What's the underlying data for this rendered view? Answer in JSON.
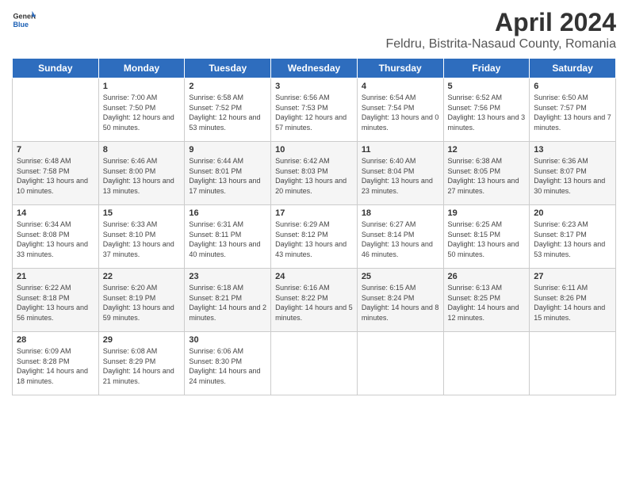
{
  "header": {
    "logo_general": "General",
    "logo_blue": "Blue",
    "title": "April 2024",
    "subtitle": "Feldru, Bistrita-Nasaud County, Romania"
  },
  "calendar": {
    "days_of_week": [
      "Sunday",
      "Monday",
      "Tuesday",
      "Wednesday",
      "Thursday",
      "Friday",
      "Saturday"
    ],
    "weeks": [
      [
        {
          "day": "",
          "content": ""
        },
        {
          "day": "1",
          "content": "Sunrise: 7:00 AM\nSunset: 7:50 PM\nDaylight: 12 hours\nand 50 minutes."
        },
        {
          "day": "2",
          "content": "Sunrise: 6:58 AM\nSunset: 7:52 PM\nDaylight: 12 hours\nand 53 minutes."
        },
        {
          "day": "3",
          "content": "Sunrise: 6:56 AM\nSunset: 7:53 PM\nDaylight: 12 hours\nand 57 minutes."
        },
        {
          "day": "4",
          "content": "Sunrise: 6:54 AM\nSunset: 7:54 PM\nDaylight: 13 hours\nand 0 minutes."
        },
        {
          "day": "5",
          "content": "Sunrise: 6:52 AM\nSunset: 7:56 PM\nDaylight: 13 hours\nand 3 minutes."
        },
        {
          "day": "6",
          "content": "Sunrise: 6:50 AM\nSunset: 7:57 PM\nDaylight: 13 hours\nand 7 minutes."
        }
      ],
      [
        {
          "day": "7",
          "content": "Sunrise: 6:48 AM\nSunset: 7:58 PM\nDaylight: 13 hours\nand 10 minutes."
        },
        {
          "day": "8",
          "content": "Sunrise: 6:46 AM\nSunset: 8:00 PM\nDaylight: 13 hours\nand 13 minutes."
        },
        {
          "day": "9",
          "content": "Sunrise: 6:44 AM\nSunset: 8:01 PM\nDaylight: 13 hours\nand 17 minutes."
        },
        {
          "day": "10",
          "content": "Sunrise: 6:42 AM\nSunset: 8:03 PM\nDaylight: 13 hours\nand 20 minutes."
        },
        {
          "day": "11",
          "content": "Sunrise: 6:40 AM\nSunset: 8:04 PM\nDaylight: 13 hours\nand 23 minutes."
        },
        {
          "day": "12",
          "content": "Sunrise: 6:38 AM\nSunset: 8:05 PM\nDaylight: 13 hours\nand 27 minutes."
        },
        {
          "day": "13",
          "content": "Sunrise: 6:36 AM\nSunset: 8:07 PM\nDaylight: 13 hours\nand 30 minutes."
        }
      ],
      [
        {
          "day": "14",
          "content": "Sunrise: 6:34 AM\nSunset: 8:08 PM\nDaylight: 13 hours\nand 33 minutes."
        },
        {
          "day": "15",
          "content": "Sunrise: 6:33 AM\nSunset: 8:10 PM\nDaylight: 13 hours\nand 37 minutes."
        },
        {
          "day": "16",
          "content": "Sunrise: 6:31 AM\nSunset: 8:11 PM\nDaylight: 13 hours\nand 40 minutes."
        },
        {
          "day": "17",
          "content": "Sunrise: 6:29 AM\nSunset: 8:12 PM\nDaylight: 13 hours\nand 43 minutes."
        },
        {
          "day": "18",
          "content": "Sunrise: 6:27 AM\nSunset: 8:14 PM\nDaylight: 13 hours\nand 46 minutes."
        },
        {
          "day": "19",
          "content": "Sunrise: 6:25 AM\nSunset: 8:15 PM\nDaylight: 13 hours\nand 50 minutes."
        },
        {
          "day": "20",
          "content": "Sunrise: 6:23 AM\nSunset: 8:17 PM\nDaylight: 13 hours\nand 53 minutes."
        }
      ],
      [
        {
          "day": "21",
          "content": "Sunrise: 6:22 AM\nSunset: 8:18 PM\nDaylight: 13 hours\nand 56 minutes."
        },
        {
          "day": "22",
          "content": "Sunrise: 6:20 AM\nSunset: 8:19 PM\nDaylight: 13 hours\nand 59 minutes."
        },
        {
          "day": "23",
          "content": "Sunrise: 6:18 AM\nSunset: 8:21 PM\nDaylight: 14 hours\nand 2 minutes."
        },
        {
          "day": "24",
          "content": "Sunrise: 6:16 AM\nSunset: 8:22 PM\nDaylight: 14 hours\nand 5 minutes."
        },
        {
          "day": "25",
          "content": "Sunrise: 6:15 AM\nSunset: 8:24 PM\nDaylight: 14 hours\nand 8 minutes."
        },
        {
          "day": "26",
          "content": "Sunrise: 6:13 AM\nSunset: 8:25 PM\nDaylight: 14 hours\nand 12 minutes."
        },
        {
          "day": "27",
          "content": "Sunrise: 6:11 AM\nSunset: 8:26 PM\nDaylight: 14 hours\nand 15 minutes."
        }
      ],
      [
        {
          "day": "28",
          "content": "Sunrise: 6:09 AM\nSunset: 8:28 PM\nDaylight: 14 hours\nand 18 minutes."
        },
        {
          "day": "29",
          "content": "Sunrise: 6:08 AM\nSunset: 8:29 PM\nDaylight: 14 hours\nand 21 minutes."
        },
        {
          "day": "30",
          "content": "Sunrise: 6:06 AM\nSunset: 8:30 PM\nDaylight: 14 hours\nand 24 minutes."
        },
        {
          "day": "",
          "content": ""
        },
        {
          "day": "",
          "content": ""
        },
        {
          "day": "",
          "content": ""
        },
        {
          "day": "",
          "content": ""
        }
      ]
    ]
  }
}
